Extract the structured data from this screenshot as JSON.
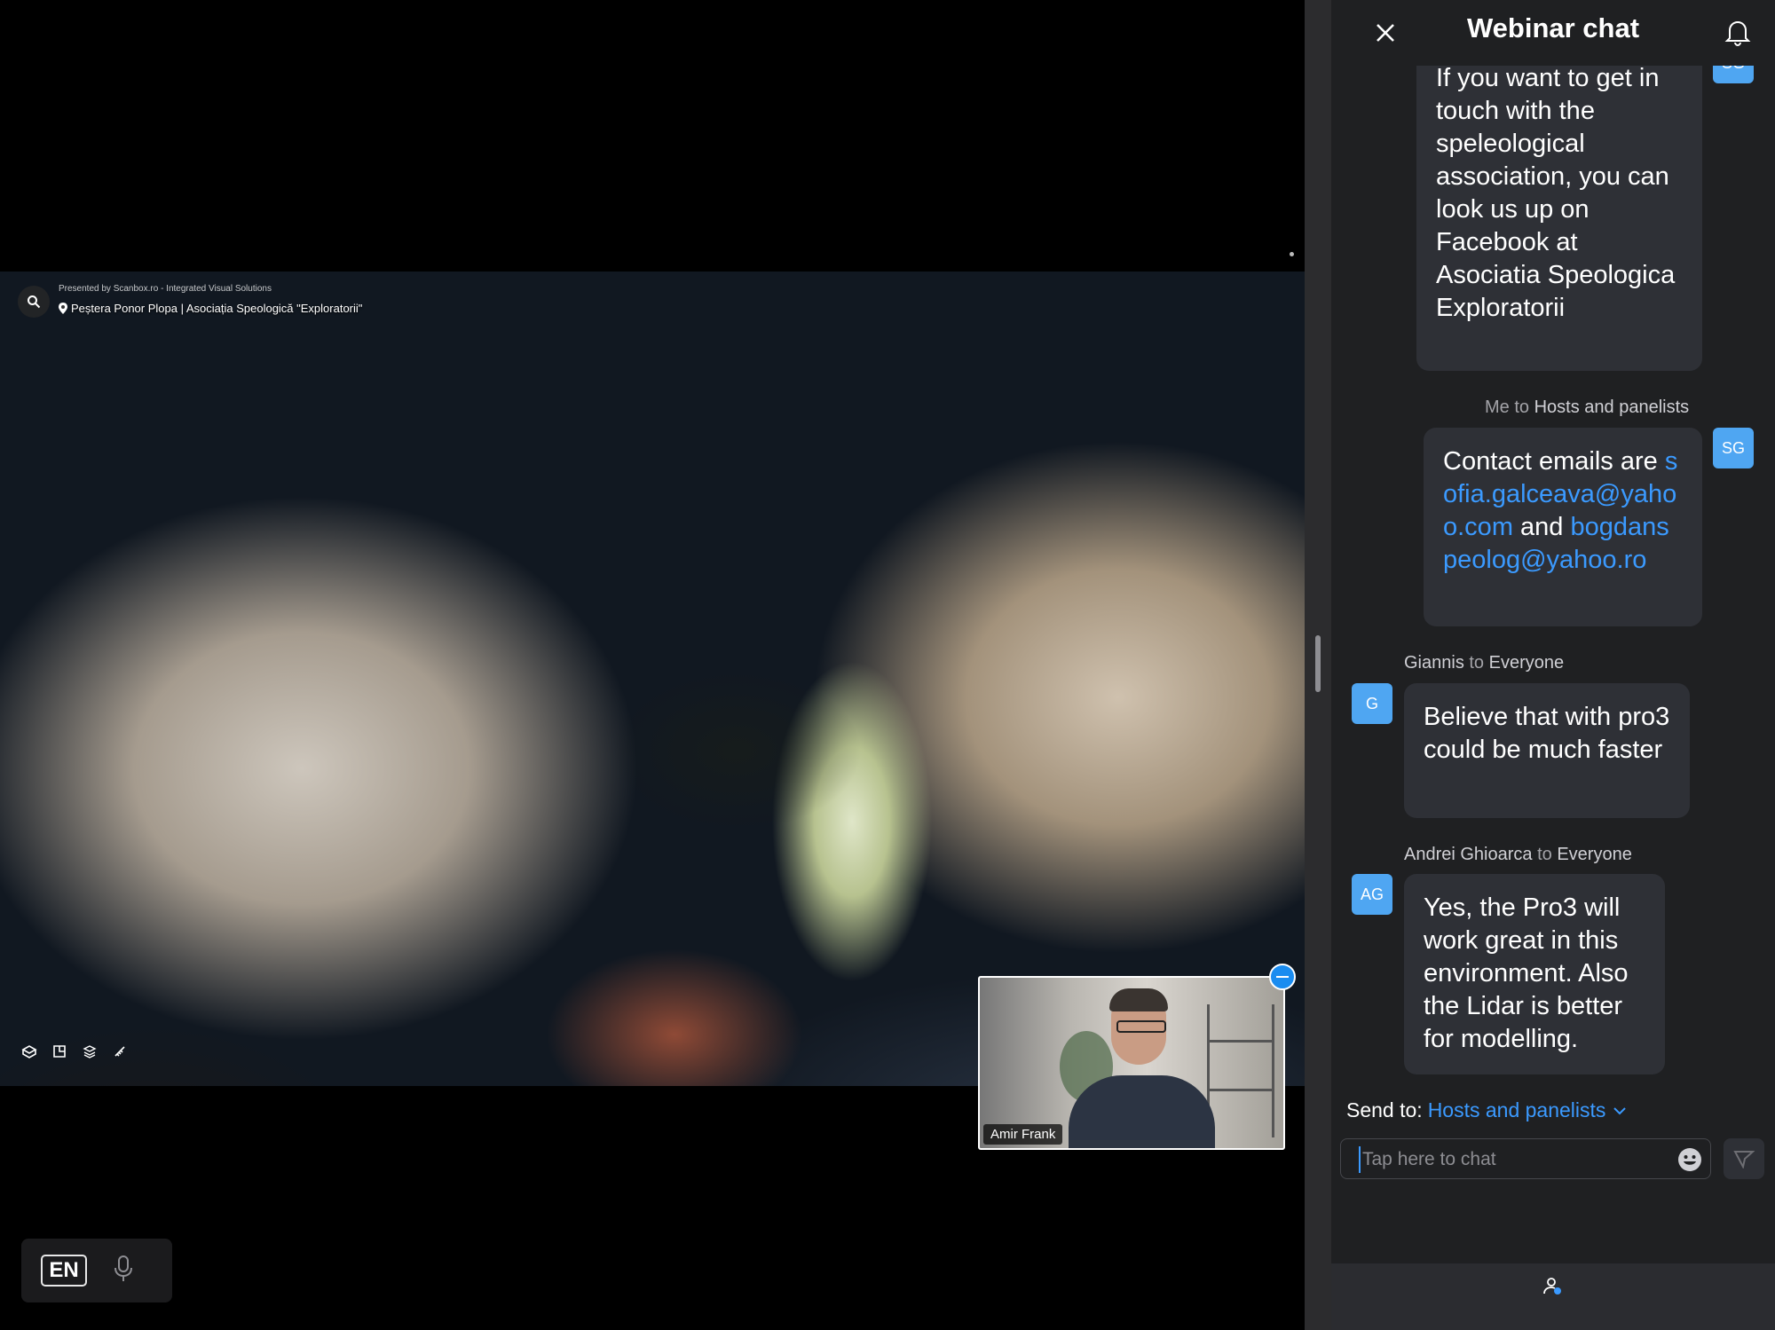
{
  "share": {
    "credit": "Presented by Scanbox.ro - Integrated Visual Solutions",
    "location": "Peștera Ponor Plopa | Asociația Speologică \"Exploratorii\""
  },
  "pip": {
    "name": "Amir Frank"
  },
  "language": {
    "code": "EN"
  },
  "chat": {
    "title": "Webinar chat",
    "messages": [
      {
        "avatar": "SG",
        "text": "If you want to get in touch with the speleological association, you can look us up on Facebook at Asociatia Speologica Exploratorii"
      },
      {
        "sender": "Me",
        "to_word": "to",
        "recipient": "Hosts and panelists",
        "avatar": "SG",
        "text_before": "Contact emails are",
        "email1": "sofia.galceava@yahoo.com",
        "text_mid": "and",
        "email2": "bogdanspeolog@yahoo.ro"
      },
      {
        "sender": "Giannis",
        "to_word": "to",
        "recipient": "Everyone",
        "avatar": "G",
        "text": "Believe that with pro3 could be much faster"
      },
      {
        "sender": "Andrei Ghioarca",
        "to_word": "to",
        "recipient": "Everyone",
        "avatar": "AG",
        "text": "Yes, the Pro3 will work great in this environment. Also the Lidar is better for modelling."
      }
    ],
    "send_to_label": "Send to:",
    "send_to_value": "Hosts and panelists",
    "input_placeholder": "Tap here to chat"
  },
  "colors": {
    "accent": "#3b9aff",
    "avatar": "#4fa6f2",
    "bubble": "#2e3036",
    "panel": "#1f2022"
  }
}
